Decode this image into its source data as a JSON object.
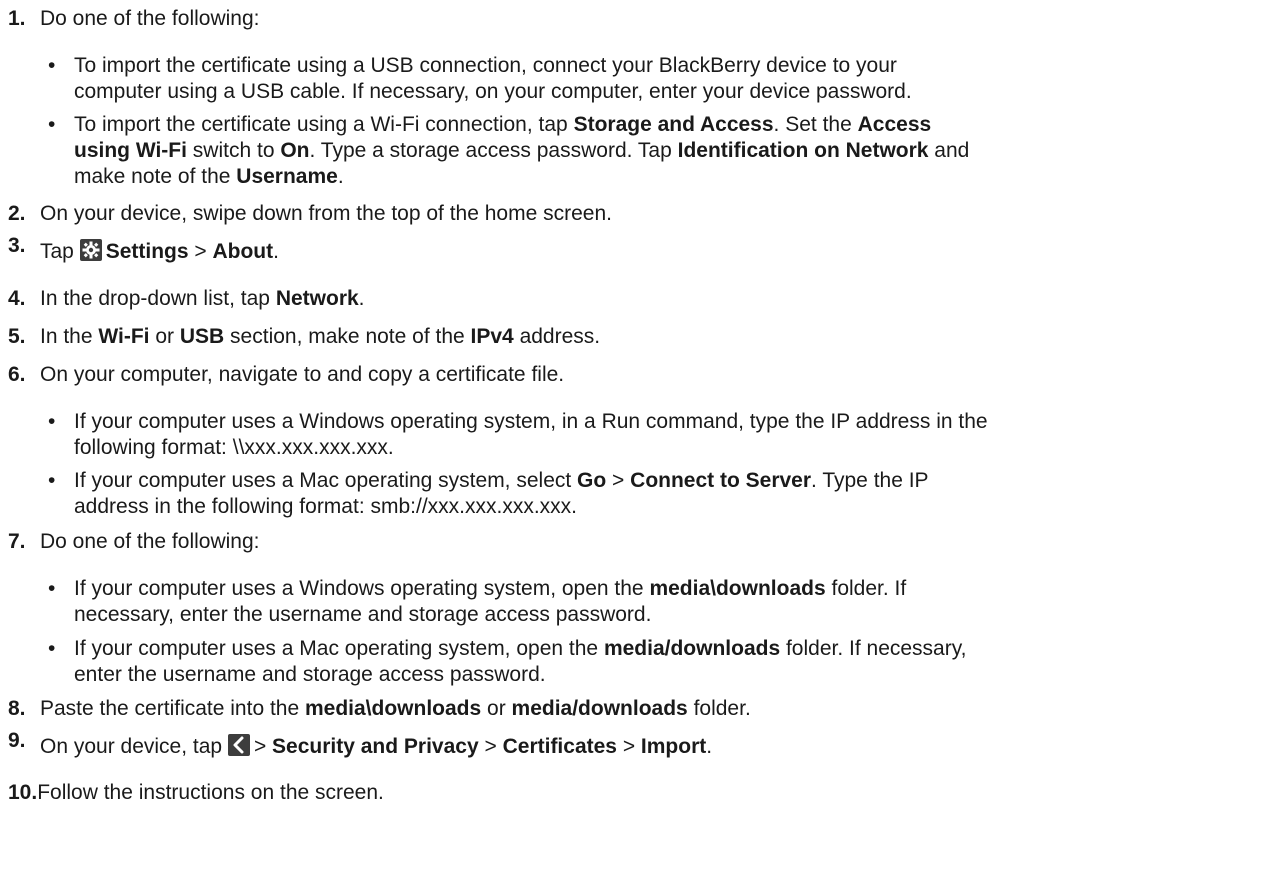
{
  "steps": [
    {
      "num": "1.",
      "text": "Do one of the following:",
      "bullets": [
        {
          "line1": [
            {
              "t": "To import the certificate using a USB connection, connect your BlackBerry device to your"
            }
          ],
          "line2": [
            {
              "t": "computer using a USB cable. If necessary, on your computer, enter your device password."
            }
          ]
        },
        {
          "line1": [
            {
              "t": "To import the certificate using a Wi-Fi connection, tap "
            },
            {
              "t": "Storage and Access",
              "b": true
            },
            {
              "t": ". Set the "
            },
            {
              "t": "Access",
              "b": true
            }
          ],
          "line2": [
            {
              "t": "using Wi-Fi",
              "b": true
            },
            {
              "t": " switch to "
            },
            {
              "t": "On",
              "b": true
            },
            {
              "t": ". Type a storage access password. Tap "
            },
            {
              "t": "Identification on Network",
              "b": true
            },
            {
              "t": " and"
            }
          ],
          "line3": [
            {
              "t": "make note of the "
            },
            {
              "t": "Username",
              "b": true
            },
            {
              "t": "."
            }
          ]
        }
      ]
    },
    {
      "num": "2.",
      "parts": [
        {
          "t": "On your device, swipe down from the top of the home screen."
        }
      ]
    },
    {
      "num": "3.",
      "parts": [
        {
          "t": "Tap "
        },
        {
          "icon": "settings-gear-icon"
        },
        {
          "t": "Settings",
          "b": true
        },
        {
          "t": " > "
        },
        {
          "t": "About",
          "b": true
        },
        {
          "t": "."
        }
      ]
    },
    {
      "num": "4.",
      "parts": [
        {
          "t": "In the drop-down list, tap "
        },
        {
          "t": "Network",
          "b": true
        },
        {
          "t": "."
        }
      ]
    },
    {
      "num": "5.",
      "parts": [
        {
          "t": "In the "
        },
        {
          "t": "Wi-Fi",
          "b": true
        },
        {
          "t": " or "
        },
        {
          "t": "USB",
          "b": true
        },
        {
          "t": " section, make note of the "
        },
        {
          "t": "IPv4",
          "b": true
        },
        {
          "t": " address."
        }
      ]
    },
    {
      "num": "6.",
      "text": "On your computer, navigate to and copy a certificate file.",
      "bullets": [
        {
          "line1": [
            {
              "t": "If your computer uses a Windows operating system, in a Run command, type the IP address in the"
            }
          ],
          "line2": [
            {
              "t": "following format: \\\\xxx.xxx.xxx.xxx."
            }
          ]
        },
        {
          "line1": [
            {
              "t": "If your computer uses a Mac operating system, select "
            },
            {
              "t": "Go",
              "b": true
            },
            {
              "t": " > "
            },
            {
              "t": "Connect to Server",
              "b": true
            },
            {
              "t": ". Type the IP"
            }
          ],
          "line2": [
            {
              "t": "address in the following format: smb://xxx.xxx.xxx.xxx."
            }
          ]
        }
      ]
    },
    {
      "num": "7.",
      "text": "Do one of the following:",
      "bullets": [
        {
          "line1": [
            {
              "t": "If your computer uses a Windows operating system, open the "
            },
            {
              "t": "media\\downloads",
              "b": true
            },
            {
              "t": " folder. If"
            }
          ],
          "line2": [
            {
              "t": "necessary, enter the username and storage access password."
            }
          ]
        },
        {
          "line1": [
            {
              "t": "If your computer uses a Mac operating system, open the "
            },
            {
              "t": "media/downloads",
              "b": true
            },
            {
              "t": " folder. If necessary,"
            }
          ],
          "line2": [
            {
              "t": "enter the username and storage access password."
            }
          ]
        }
      ]
    },
    {
      "num": "8.",
      "parts": [
        {
          "t": "Paste the certificate into the "
        },
        {
          "t": "media\\downloads",
          "b": true
        },
        {
          "t": " or "
        },
        {
          "t": "media/downloads",
          "b": true
        },
        {
          "t": " folder."
        }
      ]
    },
    {
      "num": "9.",
      "parts": [
        {
          "t": "On your device, tap "
        },
        {
          "icon": "back-chevron-icon"
        },
        {
          "t": "> "
        },
        {
          "t": "Security and Privacy",
          "b": true
        },
        {
          "t": " > "
        },
        {
          "t": "Certificates",
          "b": true
        },
        {
          "t": " > "
        },
        {
          "t": "Import",
          "b": true
        },
        {
          "t": "."
        }
      ]
    },
    {
      "num": "10.",
      "parts": [
        {
          "t": "Follow the instructions on the screen."
        }
      ]
    }
  ],
  "bullet_char": "•",
  "colors": {
    "text": "#1a1a1a",
    "icon_bg": "#3d3d3d",
    "icon_fg": "#ffffff"
  }
}
